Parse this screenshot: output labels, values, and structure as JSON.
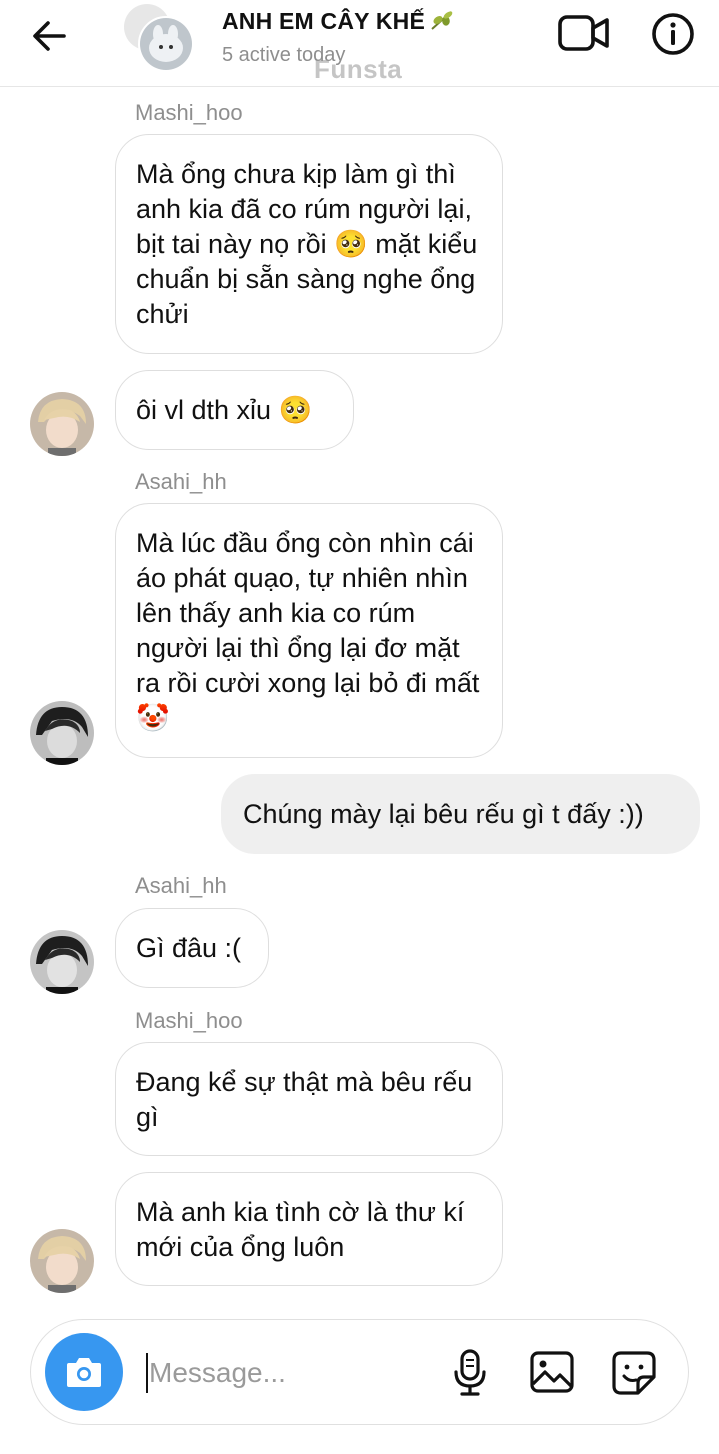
{
  "header": {
    "title": "ANH EM CÂY KHẾ",
    "subtitle": "5 active today",
    "watermark": "Funsta"
  },
  "messages": [
    {
      "sender": "Mashi_hoo",
      "text": "Mà ổng chưa kịp làm gì thì anh kia đã co rúm người lại, bịt tai này nọ rồi 🥺 mặt kiểu chuẩn bị sẵn sàng nghe ổng chửi"
    },
    {
      "text": "ôi vl dth xỉu 🥺"
    },
    {
      "sender": "Asahi_hh",
      "text": "Mà lúc đầu ổng còn nhìn cái áo phát quạo, tự nhiên nhìn lên thấy anh kia co rúm người lại thì ổng lại đơ mặt ra rồi cười  xong lại bỏ đi mất 🤡"
    },
    {
      "text": "Chúng mày lại bêu rếu gì t đấy :))"
    },
    {
      "sender": "Asahi_hh",
      "text": "Gì đâu :("
    },
    {
      "sender": "Mashi_hoo",
      "text": "Đang kể sự thật mà bêu rếu gì"
    },
    {
      "text": "Mà anh kia tình cờ là thư kí mới của ổng luôn"
    }
  ],
  "composer": {
    "placeholder": "Message..."
  },
  "colors": {
    "accent": "#3797f0",
    "outgoing_bubble": "#efefef",
    "muted_text": "#8e8e8e"
  },
  "icons": [
    "back-arrow-icon",
    "video-call-icon",
    "info-icon",
    "camera-icon",
    "microphone-icon",
    "gallery-icon",
    "sticker-icon",
    "olive-emoji-icon",
    "pleading-face-emoji",
    "clown-face-emoji"
  ]
}
